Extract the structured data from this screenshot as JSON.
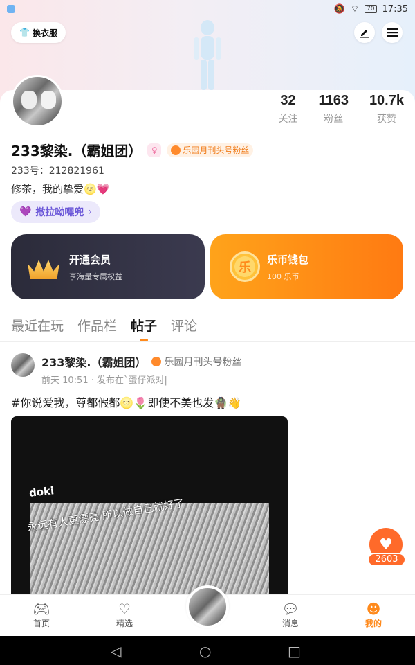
{
  "status_bar": {
    "time": "17:35",
    "battery": "70"
  },
  "header": {
    "outfit_label": "换衣服"
  },
  "profile": {
    "username": "233黎染.（霸姐团）",
    "fan_badge": "乐园月刊头号粉丝",
    "user_id": "233号：212821961",
    "bio": "修茶，我的挚爱🌝💗",
    "tag": "撒拉呦嘿兜",
    "stats": [
      {
        "value": "32",
        "label": "关注"
      },
      {
        "value": "1163",
        "label": "粉丝"
      },
      {
        "value": "10.7k",
        "label": "获赞"
      }
    ]
  },
  "cards": {
    "vip": {
      "title": "开通会员",
      "subtitle": "享海量专属权益"
    },
    "wallet": {
      "title": "乐币钱包",
      "subtitle": "100 乐币",
      "coin_glyph": "乐"
    }
  },
  "tabs": [
    {
      "label": "最近在玩"
    },
    {
      "label": "作品栏"
    },
    {
      "label": "帖子"
    },
    {
      "label": "评论"
    }
  ],
  "post": {
    "author": "233黎染.（霸姐团）",
    "badge": "乐园月刊头号粉丝",
    "meta": "前天 10:51 · 发布在`蛋仔派对|",
    "text": "#你说爱我，尊都假都🌝🌷即使不美也发🧌👋",
    "image_sticker_top": "doki",
    "image_sticker_line": "永远有人更漂亮 所以做自己就好了"
  },
  "like": {
    "count": "2603"
  },
  "bottom_nav": [
    {
      "label": "首页",
      "icon": "gamepad-icon"
    },
    {
      "label": "精选",
      "icon": "heart-outline-icon"
    },
    {
      "label": "消息",
      "icon": "chat-icon"
    },
    {
      "label": "我的",
      "icon": "smile-icon"
    }
  ],
  "colors": {
    "accent": "#ff8a1c",
    "vip_bg": "#2b2b3a",
    "wallet_bg": "#ff8a1c",
    "tag_purple": "#6b57d8"
  }
}
